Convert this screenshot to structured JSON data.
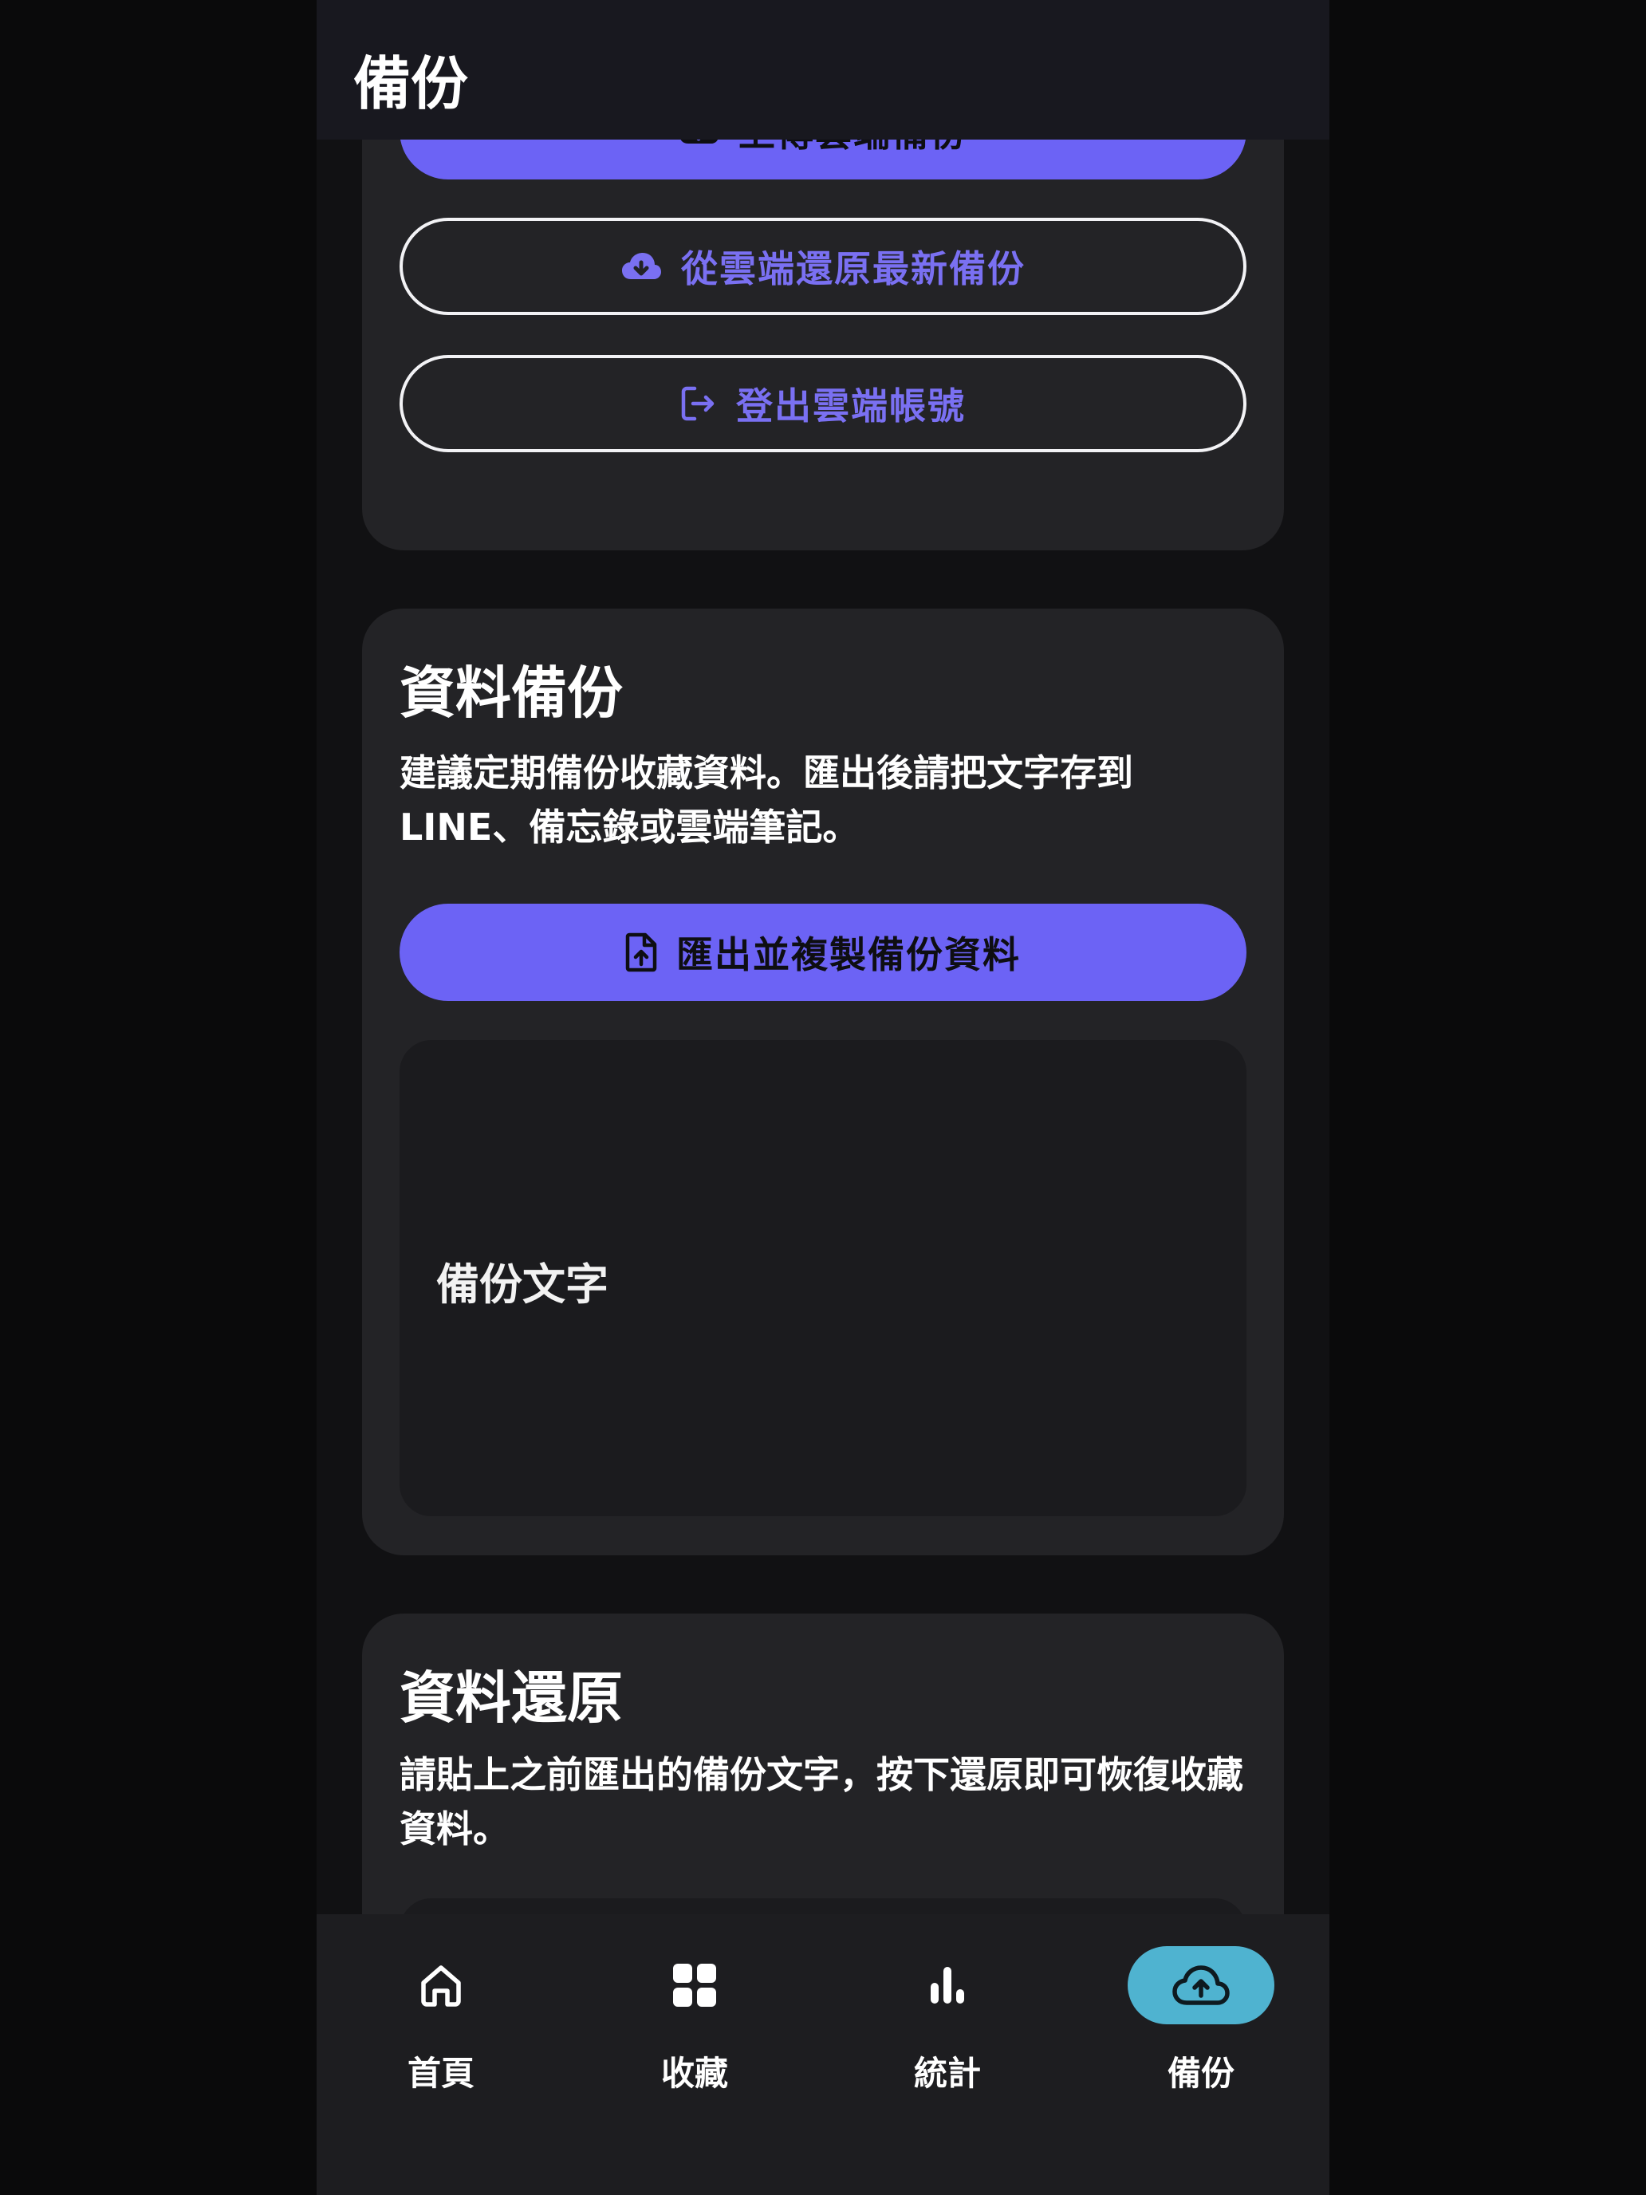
{
  "appbar": {
    "title": "備份"
  },
  "cloud_card": {
    "upload_label": "上傳雲端備份",
    "restore_label": "從雲端還原最新備份",
    "logout_label": "登出雲端帳號"
  },
  "backup_card": {
    "title": "資料備份",
    "description": "建議定期備份收藏資料。匯出後請把文字存到 LINE、備忘錄或雲端筆記。",
    "export_label": "匯出並複製備份資料",
    "textbox_placeholder": "備份文字"
  },
  "restore_card": {
    "title": "資料還原",
    "description": "請貼上之前匯出的備份文字，按下還原即可恢復收藏資料。"
  },
  "bottom_nav": {
    "items": [
      {
        "label": "首頁",
        "icon": "home-icon"
      },
      {
        "label": "收藏",
        "icon": "grid-icon"
      },
      {
        "label": "統計",
        "icon": "bar-chart-icon"
      },
      {
        "label": "備份",
        "icon": "cloud-upload-icon",
        "active": true
      }
    ]
  },
  "colors": {
    "accent": "#6c63f5",
    "active_nav": "#4fb3d0",
    "background": "#111113",
    "card": "#232326"
  }
}
